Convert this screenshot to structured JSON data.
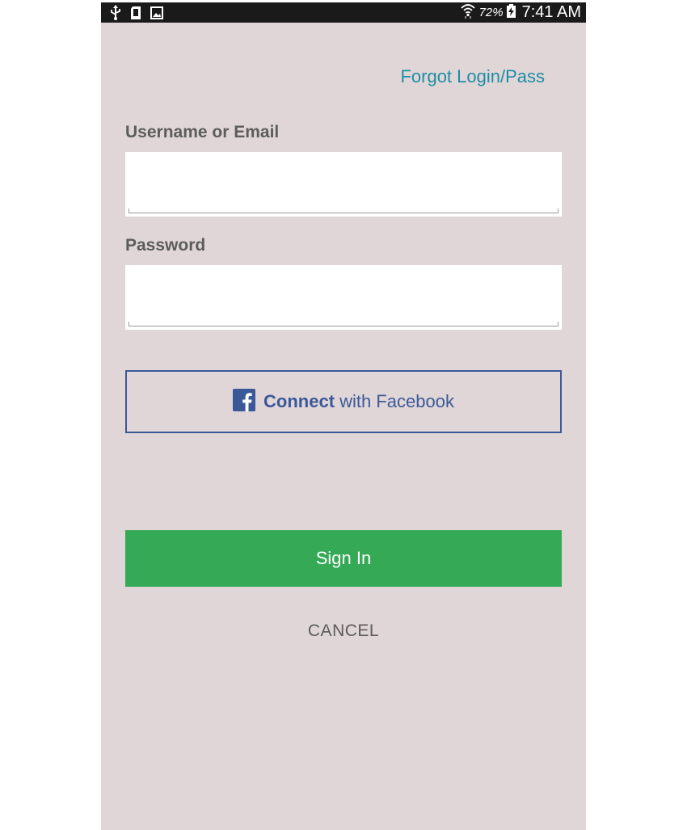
{
  "status_bar": {
    "battery_percent": "72%",
    "time": "7:41 AM",
    "icons": [
      "usb-icon",
      "sd-card-icon",
      "image-icon",
      "wifi-icon",
      "battery-charging-icon"
    ]
  },
  "login": {
    "forgot_link": "Forgot Login/Pass",
    "username_label": "Username or Email",
    "username_value": "",
    "password_label": "Password",
    "password_value": "",
    "facebook_bold": "Connect",
    "facebook_rest": " with Facebook",
    "signin_label": "Sign In",
    "cancel_label": "CANCEL"
  },
  "colors": {
    "background": "#e0d6d8",
    "accent_link": "#1e8ea3",
    "facebook": "#3b5998",
    "signin_green": "#35a955",
    "label_text": "#5c5c5c"
  }
}
